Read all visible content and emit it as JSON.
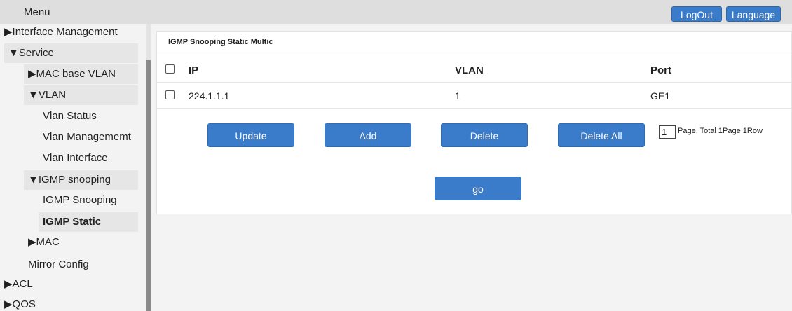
{
  "topbar": {
    "menu_label": "Menu",
    "logout_label": "LogOut",
    "language_label": "Language"
  },
  "sidebar": {
    "items": [
      {
        "label": "▶Interface Management"
      },
      {
        "label": "▼Service"
      },
      {
        "label": "▶MAC base VLAN"
      },
      {
        "label": "▼VLAN"
      },
      {
        "label": "Vlan Status"
      },
      {
        "label": "Vlan Managememt"
      },
      {
        "label": "Vlan Interface"
      },
      {
        "label": "▼IGMP snooping"
      },
      {
        "label": "IGMP Snooping"
      },
      {
        "label": "IGMP Static"
      },
      {
        "label": "▶MAC"
      },
      {
        "label": "Mirror Config"
      },
      {
        "label": "▶ACL"
      },
      {
        "label": "▶QOS"
      }
    ]
  },
  "panel": {
    "title": "IGMP Snooping Static Multic",
    "columns": {
      "ip": "IP",
      "vlan": "VLAN",
      "port": "Port"
    },
    "rows": [
      {
        "ip": "224.1.1.1",
        "vlan": "1",
        "port": "GE1"
      }
    ],
    "buttons": {
      "update": "Update",
      "add": "Add",
      "delete": "Delete",
      "delete_all": "Delete All",
      "go": "go"
    },
    "pagination": {
      "page_value": "1",
      "info": "Page, Total 1Page 1Row"
    }
  },
  "colors": {
    "accent": "#3a7cc9",
    "topbar_bg": "#dedede",
    "page_bg": "#f3f3f3"
  }
}
